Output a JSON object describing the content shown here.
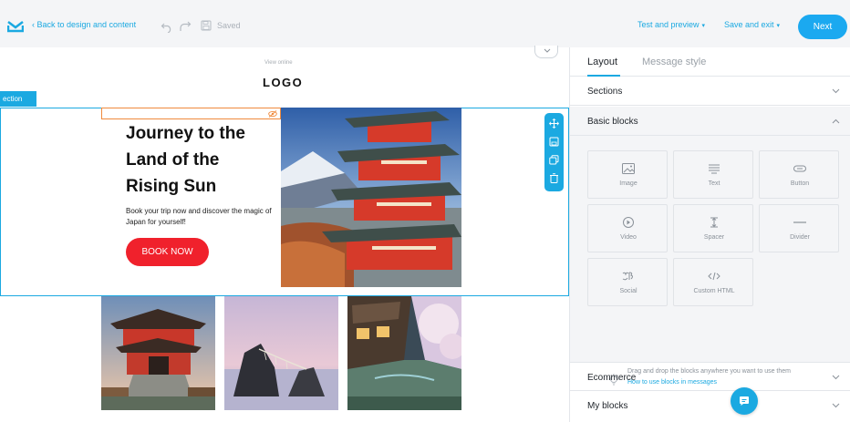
{
  "topbar": {
    "back_label": "Back to design and content",
    "saved_label": "Saved",
    "test_preview_label": "Test and preview",
    "save_exit_label": "Save and exit",
    "next_label": "Next",
    "accent_color": "#1ba9e1"
  },
  "email": {
    "view_online": "View online",
    "logo_text": "LOGO",
    "section_tag": "ection",
    "hero_title": "Journey to the Land of the Rising Sun",
    "hero_subtitle": "Book your trip now and discover the magic of Japan for yourself!",
    "cta_label": "BOOK NOW",
    "cta_color": "#f0212c"
  },
  "panel": {
    "tabs": [
      {
        "label": "Layout",
        "active": true
      },
      {
        "label": "Message style",
        "active": false
      }
    ],
    "sections_label": "Sections",
    "basic_blocks_label": "Basic blocks",
    "blocks": [
      {
        "label": "Image",
        "icon": "image-icon"
      },
      {
        "label": "Text",
        "icon": "text-icon"
      },
      {
        "label": "Button",
        "icon": "button-icon"
      },
      {
        "label": "Video",
        "icon": "video-icon"
      },
      {
        "label": "Spacer",
        "icon": "spacer-icon"
      },
      {
        "label": "Divider",
        "icon": "divider-icon"
      },
      {
        "label": "Social",
        "icon": "social-icon"
      },
      {
        "label": "Custom HTML",
        "icon": "code-icon"
      }
    ],
    "hint_text": "Drag and drop the blocks anywhere you want to use them",
    "hint_link": "How to use blocks in messages",
    "ecommerce_label": "Ecommerce",
    "my_blocks_label": "My blocks"
  }
}
